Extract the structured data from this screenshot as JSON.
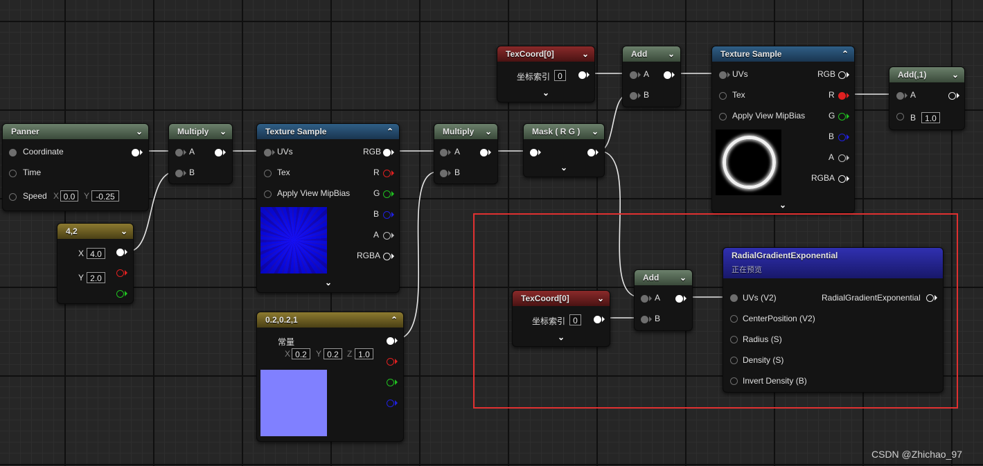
{
  "nodes": {
    "panner": {
      "title": "Panner",
      "coordinate": "Coordinate",
      "time": "Time",
      "speed": "Speed",
      "x_label": "X",
      "x_value": "0.0",
      "y_label": "Y",
      "y_value": "-0.25"
    },
    "multiply1": {
      "title": "Multiply",
      "a": "A",
      "b": "B"
    },
    "vec42": {
      "title": "4,2",
      "x_label": "X",
      "x_value": "4.0",
      "y_label": "Y",
      "y_value": "2.0"
    },
    "texsample1": {
      "title": "Texture Sample",
      "uvs": "UVs",
      "tex": "Tex",
      "mipbias": "Apply View MipBias",
      "rgb": "RGB",
      "r": "R",
      "g": "G",
      "b": "B",
      "a": "A",
      "rgba": "RGBA"
    },
    "const3": {
      "title": "0.2,0.2,1",
      "label": "常量",
      "x_label": "X",
      "x_value": "0.2",
      "y_label": "Y",
      "y_value": "0.2",
      "z_label": "Z",
      "z_value": "1.0",
      "swatch": "#8080ff"
    },
    "multiply2": {
      "title": "Multiply",
      "a": "A",
      "b": "B"
    },
    "mask": {
      "title": "Mask ( R G )"
    },
    "texcoord1": {
      "title": "TexCoord[0]",
      "label": "坐标索引",
      "value": "0"
    },
    "add1": {
      "title": "Add",
      "a": "A",
      "b": "B"
    },
    "texsample2": {
      "title": "Texture Sample",
      "uvs": "UVs",
      "tex": "Tex",
      "mipbias": "Apply View MipBias",
      "rgb": "RGB",
      "r": "R",
      "g": "G",
      "b": "B",
      "a": "A",
      "rgba": "RGBA"
    },
    "add_const": {
      "title": "Add(,1)",
      "a": "A",
      "b": "B",
      "b_value": "1.0"
    },
    "texcoord2": {
      "title": "TexCoord[0]",
      "label": "坐标索引",
      "value": "0"
    },
    "add2": {
      "title": "Add",
      "a": "A",
      "b": "B"
    },
    "radial": {
      "title": "RadialGradientExponential",
      "subtitle": "正在预览",
      "uvs": "UVs (V2)",
      "center": "CenterPosition (V2)",
      "radius": "Radius (S)",
      "density": "Density (S)",
      "invert": "Invert Density (B)",
      "output": "RadialGradientExponential"
    }
  },
  "colors": {
    "selection": "#e03030",
    "red_pin": "#e02020",
    "green_pin": "#20c020",
    "blue_pin": "#2020e0"
  },
  "watermark": "CSDN @Zhichao_97"
}
